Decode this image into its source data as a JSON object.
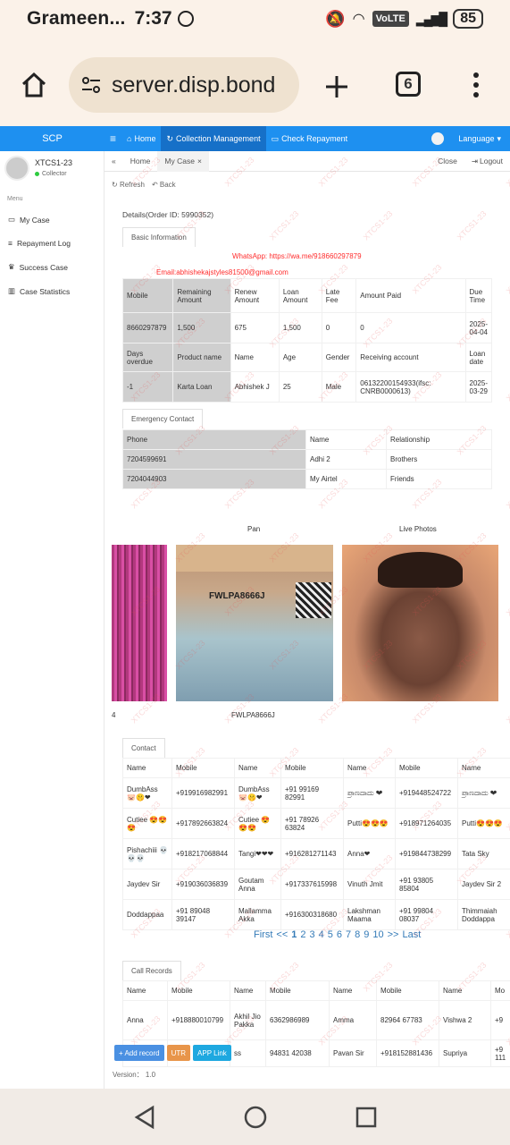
{
  "status": {
    "carrier": "Grameen...",
    "time": "7:37",
    "volte": "VoLTE",
    "battery": "85"
  },
  "browser": {
    "url": "server.disp.bond",
    "tabs_count": "6",
    "home_icon": "home-icon",
    "add_icon": "plus-icon",
    "menu_icon": "kebab-icon"
  },
  "nav": {
    "brand": "SCP",
    "hamburger": "≡",
    "home": "Home",
    "collection": "Collection Management",
    "check": "Check Repayment",
    "language": "Language"
  },
  "user": {
    "name": "XTCS1-23",
    "role": "Collector"
  },
  "sidebar": {
    "menu_label": "Menu",
    "items": [
      {
        "label": "My Case"
      },
      {
        "label": "Repayment Log"
      },
      {
        "label": "Success Case"
      },
      {
        "label": "Case Statistics"
      }
    ],
    "version": "Version： 1.0"
  },
  "tabs": {
    "back": "«",
    "home": "Home",
    "mycase": "My Case",
    "close": "Close",
    "logout": "Logout"
  },
  "toolbar": {
    "refresh": "Refresh",
    "back": "Back"
  },
  "details": {
    "title": "Details(Order ID: 5990352)",
    "basic_info": "Basic Information",
    "whatsapp": "WhatsApp: https://wa.me/918660297879",
    "email": "Email:abhishekajstyles81500@gmail.com"
  },
  "basic": {
    "r1": [
      "Mobile",
      "Remaining Amount",
      "Renew Amount",
      "Loan Amount",
      "Late Fee",
      "Amount Paid",
      "Due Time"
    ],
    "r2": [
      "8660297879",
      "1,500",
      "675",
      "1,500",
      "0",
      "0",
      "2025-04-04"
    ],
    "r3": [
      "Days overdue",
      "Product name",
      "Name",
      "Age",
      "Gender",
      "Receiving account",
      "Loan date"
    ],
    "r4": [
      "-1",
      "Karta Loan",
      "Abhishek J",
      "25",
      "Male",
      "06132200154933(ifsc: CNRB0000613)",
      "2025-03-29"
    ]
  },
  "emergency": {
    "title": "Emergency Contact",
    "headers": [
      "Phone",
      "Name",
      "Relationship"
    ],
    "rows": [
      [
        "7204599691",
        "Adhi 2",
        "Brothers"
      ],
      [
        "7204044903",
        "My Airtel",
        "Friends"
      ]
    ]
  },
  "photos": {
    "pan_label": "Pan",
    "live_label": "Live Photos",
    "pan_caption": "FWLPA8666J",
    "left_caption": "4"
  },
  "contact": {
    "title": "Contact",
    "headers": [
      "Name",
      "Mobile",
      "Name",
      "Mobile",
      "Name",
      "Mobile",
      "Name"
    ],
    "rows": [
      [
        "DumbAss 🐷🤫❤",
        "+919916982991",
        "DumbAss 🐷🤫❤",
        "+91 99169 82991",
        "ಪ್ರಾಣದಾದು ❤",
        "+919448524722",
        "ಪ್ರಾಣದಾದು ❤"
      ],
      [
        "Cutiee 😍😍😍",
        "+917892663824",
        "Cutiee 😍😍😍",
        "+91 78926 63824",
        "Putti😍😍😍",
        "+918971264035",
        "Putti😍😍😍"
      ],
      [
        "Pishachiii 💀💀💀",
        "+918217068844",
        "Tangi❤❤❤",
        "+916281271143",
        "Anna❤",
        "+919844738299",
        "Tata Sky"
      ],
      [
        "Jaydev Sir",
        "+919036036839",
        "Goutam Anna",
        "+917337615998",
        "Vinuth Jmit",
        "+91 93805 85804",
        "Jaydev Sir 2"
      ],
      [
        "Doddappaa",
        "+91 89048 39147",
        "Mallamma Akka",
        "+916300318680",
        "Lakshman Maama",
        "+91 99804 08037",
        "Thimmaiah Doddappa"
      ]
    ]
  },
  "pager": {
    "first": "First",
    "prev": "<<",
    "pages": [
      "1",
      "2",
      "3",
      "4",
      "5",
      "6",
      "7",
      "8",
      "9",
      "10"
    ],
    "next": ">>",
    "last": "Last"
  },
  "calls": {
    "title": "Call Records",
    "headers": [
      "Name",
      "Mobile",
      "Name",
      "Mobile",
      "Name",
      "Mobile",
      "Name",
      "Mo"
    ],
    "rows": [
      [
        "Anna",
        "+918880010799",
        "Akhil Jio Pakka",
        "6362986989",
        "Amma",
        "82964 67783",
        "Vishwa 2",
        "+9"
      ],
      [
        "",
        "",
        "ss",
        "94831 42038",
        "Pavan Sir",
        "+918152881436",
        "Supriya",
        "+9 111"
      ]
    ]
  },
  "buttons": {
    "add": "+ Add record",
    "utr": "UTR",
    "app": "APP Link"
  },
  "watermark_text": "XTCS1-23",
  "colors": {
    "nav_blue": "#1e90f0",
    "nav_active": "#1670c8",
    "link": "#337ab7",
    "add": "#4a90e2",
    "utr": "#e8954a",
    "app": "#1ea8e0"
  }
}
